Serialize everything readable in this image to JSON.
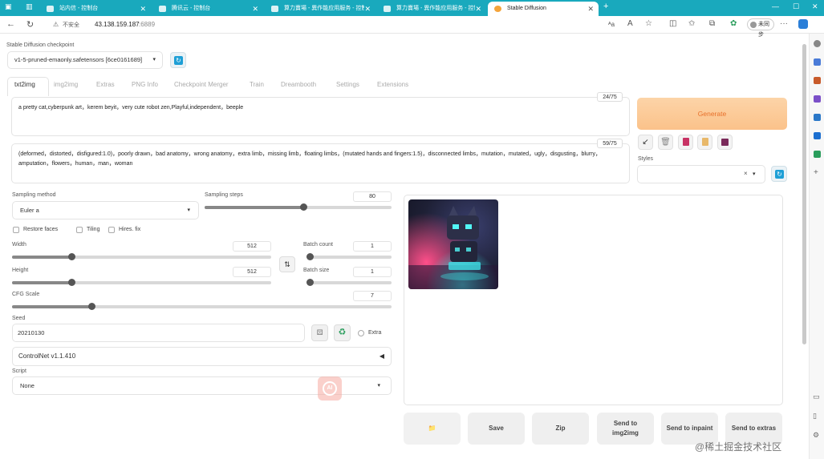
{
  "browser": {
    "tabs": [
      {
        "title": "站内信 - 控制台",
        "active": false
      },
      {
        "title": "腾讯云 - 控制台",
        "active": false
      },
      {
        "title": "算力賣場 - 異作能应用服务 - 控制",
        "active": false
      },
      {
        "title": "算力賣場 - 異作能应用服务 - 控制",
        "active": false
      },
      {
        "title": "Stable Diffusion",
        "active": true
      }
    ],
    "security": "不安全",
    "url_host": "43.138.159.187",
    "url_port": ":6889",
    "sync_label": "未同步"
  },
  "checkpoint": {
    "label": "Stable Diffusion checkpoint",
    "value": "v1-5-pruned-emaonly.safetensors [6ce0161689]"
  },
  "tabs": [
    "txt2img",
    "img2img",
    "Extras",
    "PNG Info",
    "Checkpoint Merger",
    "Train",
    "Dreambooth",
    "Settings",
    "Extensions"
  ],
  "prompt": {
    "text": "a pretty cat,cyberpunk art，kerem beyit，very cute robot zen,Playful,independent，beeple",
    "count": "24/75"
  },
  "negative": {
    "text": "(deformed，distorted，disfigured:1.0)，poorly drawn，bad anatomy，wrong anatomy，extra limb，missing limb，floating limbs，(mutated hands and fingers:1.5)，disconnected limbs，mutation，mutated，ugly，disgusting，blurry，amputation，flowers，human，man，woman",
    "count": "59/75"
  },
  "generate_label": "Generate",
  "styles_label": "Styles",
  "sampling": {
    "method_label": "Sampling method",
    "method_value": "Euler a",
    "steps_label": "Sampling steps",
    "steps_value": "80",
    "steps_fraction": 0.53
  },
  "options": {
    "restore_faces": "Restore faces",
    "tiling": "Tiling",
    "hires_fix": "Hires. fix"
  },
  "width": {
    "label": "Width",
    "value": "512",
    "fraction": 0.23
  },
  "height": {
    "label": "Height",
    "value": "512",
    "fraction": 0.23
  },
  "batch_count": {
    "label": "Batch count",
    "value": "1",
    "fraction": 0.0
  },
  "batch_size": {
    "label": "Batch size",
    "value": "1",
    "fraction": 0.0
  },
  "cfg": {
    "label": "CFG Scale",
    "value": "7",
    "fraction": 0.21
  },
  "seed": {
    "label": "Seed",
    "value": "20210130",
    "extra_label": "Extra"
  },
  "controlnet_label": "ControlNet v1.1.410",
  "script": {
    "label": "Script",
    "value": "None"
  },
  "output_buttons": [
    "📁",
    "Save",
    "Zip",
    "Send to img2img",
    "Send to inpaint",
    "Send to extras"
  ],
  "watermark": "@稀土掘金技术社区",
  "colors": {
    "tabbar": "#19a9bd",
    "generate": "#fbc58f",
    "generate_text": "#e8702a"
  }
}
